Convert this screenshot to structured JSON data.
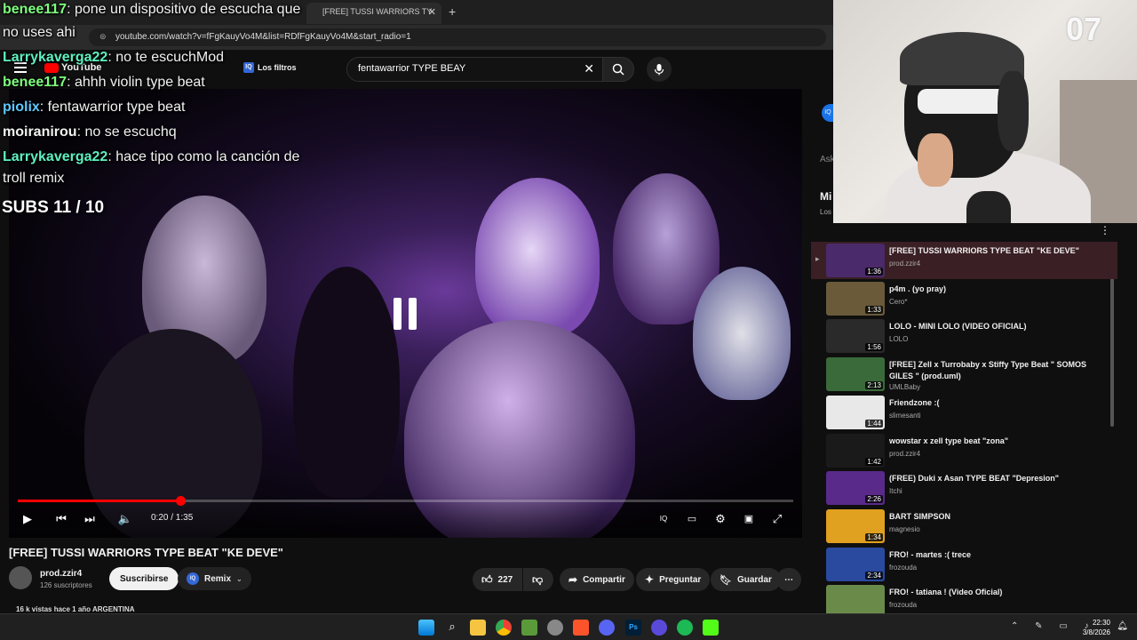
{
  "browser": {
    "tab_title": "[FREE] TUSSI WARRIORS TY",
    "new_tab_icon": "plus-icon",
    "url": "youtube.com/watch?v=fFgKauyVo4M&list=RDfFgKauyVo4M&start_radio=1"
  },
  "youtube": {
    "logo_text": "YouTube",
    "filters_label": "Los filtros",
    "search_query": "fentawarrior TYPE BEAY"
  },
  "chat": [
    {
      "user": "benee117",
      "message": ": pone un dispositivo de escucha que",
      "color": "#7dff7d"
    },
    {
      "user": "",
      "message": "no uses ahi",
      "color": "#f2f2f2"
    },
    {
      "user": "Larrykaverga22",
      "message": ": no te escuchMod",
      "color": "#5ef0c0"
    },
    {
      "user": "benee117",
      "message": ": ahhh violin type beat",
      "color": "#7dff7d"
    },
    {
      "user": "piolix",
      "message": ": fentawarrior type beat",
      "color": "#5ec8ff"
    },
    {
      "user": "moiranirou",
      "message": ": no se escuchq",
      "color": "#f2f2f2"
    },
    {
      "user": "Larrykaverga22",
      "message": ": hace tipo como la canción de",
      "color": "#5ef0c0"
    },
    {
      "user": "",
      "message": "troll remix",
      "color": "#f2f2f2"
    }
  ],
  "subs_counter": "SUBS 11 / 10",
  "player": {
    "time": "0:20 / 1:35",
    "progress": 0.21,
    "state": "paused-overlay"
  },
  "video": {
    "title": "[FREE] TUSSI WARRIORS TYPE BEAT \"KE DEVE\"",
    "channel": "prod.zzir4",
    "subscribers": "126 suscriptores",
    "subscribe_label": "Suscribirse",
    "remix_label": "Remix",
    "likes": "227",
    "share_label": "Compartir",
    "ask_label": "Preguntar",
    "save_label": "Guardar",
    "meta": "16 k vistas  hace 1 año  ARGENTINA"
  },
  "sidebar_partial": {
    "ask_fragment": "Ask",
    "mix_fragment": "Mi",
    "los_fragment": "Los"
  },
  "playlist": [
    {
      "title": "[FREE] TUSSI WARRIORS TYPE BEAT \"KE DEVE\"",
      "channel": "prod.zzir4",
      "duration": "1:36",
      "thumb": "#4a2a6a",
      "active": true
    },
    {
      "title": "p4m . (yo pray)",
      "channel": "Cero*",
      "duration": "1:33",
      "thumb": "#6a5a3a",
      "active": false
    },
    {
      "title": "LOLO - MINI LOLO (VIDEO OFICIAL)",
      "channel": "LOLO",
      "duration": "1:56",
      "thumb": "#2a2a2a",
      "active": false
    },
    {
      "title": "[FREE] Zell x Turrobaby x Stiffy Type Beat \" SOMOS GILES \" (prod.uml)",
      "channel": "UMLBaby",
      "duration": "2:13",
      "thumb": "#3a6a3a",
      "active": false
    },
    {
      "title": "Friendzone :(",
      "channel": "slimesanti",
      "duration": "1:44",
      "thumb": "#e8e8e8",
      "active": false
    },
    {
      "title": "wowstar x zell type beat \"zona\"",
      "channel": "prod.zzir4",
      "duration": "1:42",
      "thumb": "#1a1a1a",
      "active": false
    },
    {
      "title": "(FREE) Duki x Asan TYPE BEAT \"Depresion\"",
      "channel": "Itchi",
      "duration": "2:26",
      "thumb": "#5a2a8a",
      "active": false
    },
    {
      "title": "BART SIMPSON",
      "channel": "magnesio",
      "duration": "1:34",
      "thumb": "#e0a020",
      "active": false
    },
    {
      "title": "FRO! - martes :( trece",
      "channel": "frozouda",
      "duration": "2:34",
      "thumb": "#2a4aa0",
      "active": false
    },
    {
      "title": "FRO! - tatiana ! (Video Oficial)",
      "channel": "frozouda",
      "duration": "",
      "thumb": "#6a8a4a",
      "active": false
    }
  ],
  "webcam": {
    "corner_text": "07"
  },
  "taskbar": {
    "time": "22:30",
    "date": "3/8/2026"
  }
}
